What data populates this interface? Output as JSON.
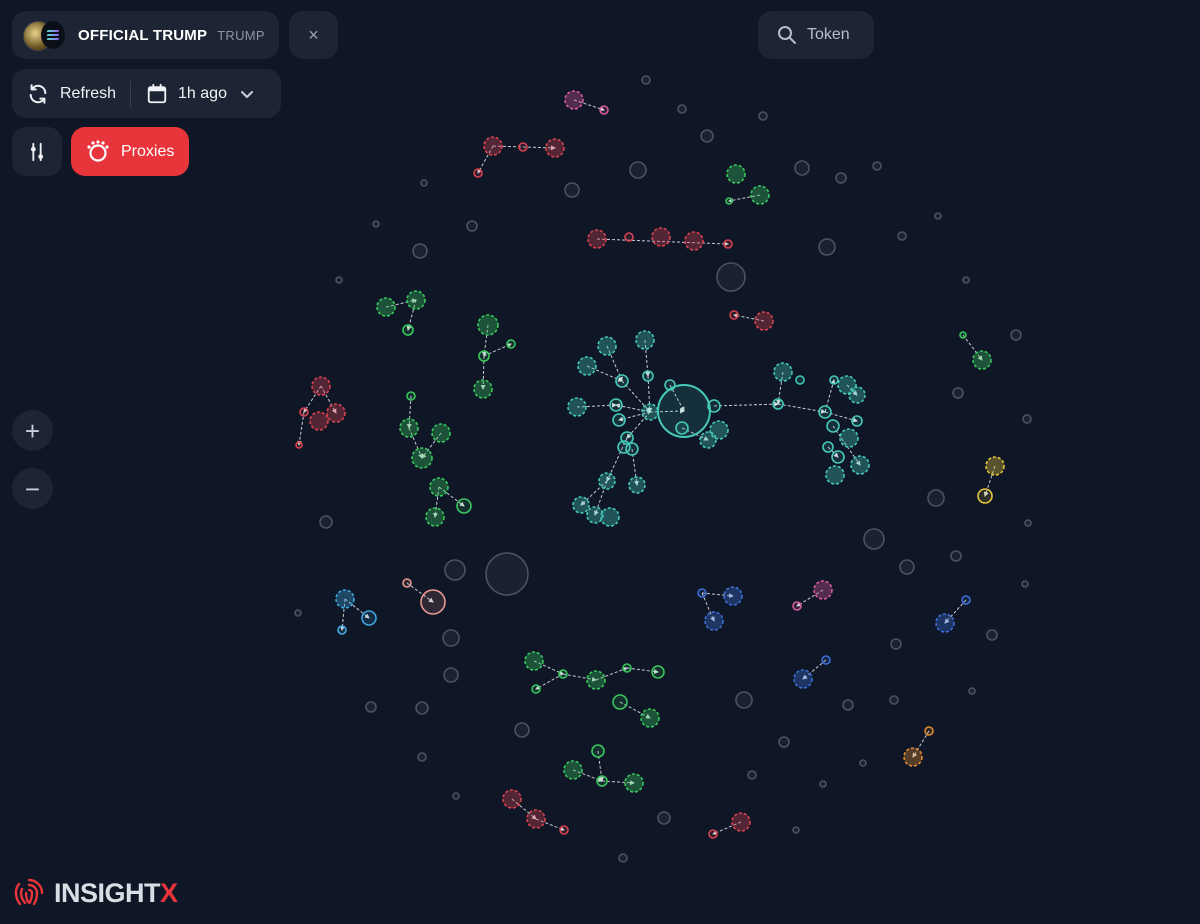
{
  "token": {
    "name": "OFFICIAL TRUMP",
    "symbol": "TRUMP",
    "logo_icon": "token-logo-icon",
    "chain_icon": "solana-icon"
  },
  "header": {
    "close_label": "×",
    "search_label": "Token"
  },
  "toolbar": {
    "refresh_label": "Refresh",
    "time_label": "1h ago"
  },
  "filters": {
    "proxies_label": "Proxies"
  },
  "zoom": {
    "in_label": "+",
    "out_label": "−"
  },
  "brand": {
    "name_main": "INSIGHT",
    "name_accent": "X"
  },
  "colors": {
    "background": "#0f1626",
    "panel": "#1d2534",
    "accent_red": "#e8343b",
    "teal": "#45c9b8",
    "green": "#38c75d",
    "red": "#d8434f",
    "pink": "#d65a9c",
    "blue": "#3d6fd6",
    "lightblue": "#3fa6e0",
    "yellow": "#e3c53a",
    "orange": "#e08a2f",
    "salmon": "#e89a90",
    "grey": "#4b5263"
  },
  "clusters": [
    {
      "color": "teal",
      "nodes": [
        [
          684,
          411,
          26
        ],
        [
          650,
          412,
          8
        ],
        [
          714,
          406,
          6
        ],
        [
          682,
          428,
          6
        ],
        [
          708,
          440,
          8
        ],
        [
          719,
          430,
          9
        ],
        [
          607,
          346,
          9
        ],
        [
          587,
          366,
          9
        ],
        [
          645,
          340,
          9
        ],
        [
          622,
          381,
          6
        ],
        [
          648,
          376,
          5
        ],
        [
          670,
          385,
          5
        ],
        [
          577,
          407,
          9
        ],
        [
          616,
          405,
          6
        ],
        [
          619,
          420,
          6
        ],
        [
          627,
          438,
          6
        ],
        [
          624,
          447,
          6
        ],
        [
          632,
          449,
          6
        ],
        [
          607,
          481,
          8
        ],
        [
          637,
          485,
          8
        ],
        [
          581,
          505,
          8
        ],
        [
          595,
          515,
          8
        ],
        [
          610,
          517,
          9
        ],
        [
          783,
          372,
          9
        ],
        [
          800,
          380,
          4
        ],
        [
          778,
          404,
          5
        ],
        [
          825,
          412,
          6
        ],
        [
          834,
          380,
          4
        ],
        [
          847,
          385,
          9
        ],
        [
          857,
          395,
          8
        ],
        [
          857,
          421,
          5
        ],
        [
          833,
          426,
          6
        ],
        [
          849,
          438,
          9
        ],
        [
          828,
          447,
          5
        ],
        [
          838,
          457,
          6
        ],
        [
          860,
          465,
          9
        ],
        [
          835,
          475,
          9
        ]
      ],
      "edges": [
        [
          650,
          412,
          684,
          411
        ],
        [
          714,
          406,
          778,
          404
        ],
        [
          778,
          404,
          825,
          412
        ],
        [
          607,
          346,
          622,
          381
        ],
        [
          587,
          366,
          622,
          381
        ],
        [
          645,
          340,
          648,
          376
        ],
        [
          577,
          407,
          616,
          405
        ],
        [
          650,
          412,
          616,
          405
        ],
        [
          650,
          412,
          619,
          420
        ],
        [
          650,
          412,
          627,
          438
        ],
        [
          627,
          438,
          607,
          481
        ],
        [
          607,
          481,
          595,
          515
        ],
        [
          607,
          481,
          581,
          505
        ],
        [
          632,
          449,
          637,
          485
        ],
        [
          783,
          372,
          778,
          404
        ],
        [
          825,
          412,
          834,
          380
        ],
        [
          825,
          412,
          857,
          421
        ],
        [
          833,
          426,
          860,
          465
        ],
        [
          828,
          447,
          838,
          457
        ],
        [
          847,
          385,
          857,
          395
        ],
        [
          682,
          428,
          708,
          440
        ],
        [
          622,
          381,
          650,
          412
        ],
        [
          648,
          376,
          650,
          412
        ],
        [
          670,
          385,
          684,
          411
        ]
      ]
    },
    {
      "color": "green",
      "nodes": [
        [
          488,
          325,
          10
        ],
        [
          484,
          356,
          5
        ],
        [
          511,
          344,
          4
        ],
        [
          483,
          389,
          9
        ],
        [
          386,
          307,
          9
        ],
        [
          416,
          300,
          9
        ],
        [
          408,
          330,
          5
        ],
        [
          411,
          396,
          4
        ],
        [
          409,
          428,
          9
        ],
        [
          441,
          433,
          9
        ],
        [
          422,
          458,
          10
        ],
        [
          439,
          487,
          9
        ],
        [
          464,
          506,
          7
        ],
        [
          435,
          517,
          9
        ],
        [
          736,
          174,
          9
        ],
        [
          760,
          195,
          9
        ],
        [
          729,
          201,
          3
        ],
        [
          982,
          360,
          9
        ],
        [
          963,
          335,
          3
        ],
        [
          534,
          661,
          9
        ],
        [
          563,
          674,
          4
        ],
        [
          536,
          689,
          4
        ],
        [
          596,
          680,
          9
        ],
        [
          627,
          668,
          4
        ],
        [
          658,
          672,
          6
        ],
        [
          620,
          702,
          7
        ],
        [
          650,
          718,
          9
        ],
        [
          598,
          751,
          6
        ],
        [
          573,
          770,
          9
        ],
        [
          602,
          781,
          5
        ],
        [
          634,
          783,
          9
        ]
      ],
      "edges": [
        [
          488,
          325,
          484,
          356
        ],
        [
          484,
          356,
          511,
          344
        ],
        [
          484,
          356,
          483,
          389
        ],
        [
          416,
          300,
          408,
          330
        ],
        [
          386,
          307,
          416,
          300
        ],
        [
          411,
          396,
          409,
          428
        ],
        [
          409,
          428,
          422,
          458
        ],
        [
          441,
          433,
          422,
          458
        ],
        [
          439,
          487,
          464,
          506
        ],
        [
          439,
          487,
          435,
          517
        ],
        [
          760,
          195,
          729,
          201
        ],
        [
          963,
          335,
          982,
          360
        ],
        [
          534,
          661,
          563,
          674
        ],
        [
          563,
          674,
          536,
          689
        ],
        [
          563,
          674,
          596,
          680
        ],
        [
          627,
          668,
          658,
          672
        ],
        [
          596,
          680,
          627,
          668
        ],
        [
          620,
          702,
          650,
          718
        ],
        [
          598,
          751,
          602,
          781
        ],
        [
          573,
          770,
          602,
          781
        ],
        [
          602,
          781,
          634,
          783
        ]
      ]
    },
    {
      "color": "red",
      "nodes": [
        [
          493,
          146,
          9
        ],
        [
          523,
          147,
          4
        ],
        [
          555,
          148,
          9
        ],
        [
          478,
          173,
          4
        ],
        [
          597,
          239,
          9
        ],
        [
          629,
          237,
          4
        ],
        [
          661,
          237,
          9
        ],
        [
          694,
          241,
          9
        ],
        [
          728,
          244,
          4
        ],
        [
          764,
          321,
          9
        ],
        [
          734,
          315,
          4
        ],
        [
          321,
          386,
          9
        ],
        [
          304,
          412,
          4
        ],
        [
          319,
          421,
          9
        ],
        [
          336,
          413,
          9
        ],
        [
          299,
          445,
          3
        ],
        [
          512,
          799,
          9
        ],
        [
          536,
          819,
          9
        ],
        [
          564,
          830,
          4
        ],
        [
          741,
          822,
          9
        ],
        [
          713,
          834,
          4
        ]
      ],
      "edges": [
        [
          493,
          146,
          555,
          148
        ],
        [
          493,
          146,
          478,
          173
        ],
        [
          597,
          239,
          728,
          244
        ],
        [
          764,
          321,
          734,
          315
        ],
        [
          321,
          386,
          304,
          412
        ],
        [
          321,
          386,
          336,
          413
        ],
        [
          304,
          412,
          299,
          445
        ],
        [
          512,
          799,
          536,
          819
        ],
        [
          536,
          819,
          564,
          830
        ],
        [
          741,
          822,
          713,
          834
        ]
      ]
    },
    {
      "color": "pink",
      "nodes": [
        [
          574,
          100,
          9
        ],
        [
          604,
          110,
          4
        ],
        [
          823,
          590,
          9
        ],
        [
          797,
          606,
          4
        ]
      ],
      "edges": [
        [
          574,
          100,
          604,
          110
        ],
        [
          823,
          590,
          797,
          606
        ]
      ]
    },
    {
      "color": "blue",
      "nodes": [
        [
          733,
          596,
          9
        ],
        [
          702,
          593,
          4
        ],
        [
          714,
          621,
          9
        ],
        [
          945,
          623,
          9
        ],
        [
          966,
          600,
          4
        ],
        [
          803,
          679,
          9
        ],
        [
          826,
          660,
          4
        ]
      ],
      "edges": [
        [
          702,
          593,
          733,
          596
        ],
        [
          702,
          593,
          714,
          621
        ],
        [
          966,
          600,
          945,
          623
        ],
        [
          826,
          660,
          803,
          679
        ]
      ]
    },
    {
      "color": "lightblue",
      "nodes": [
        [
          345,
          599,
          9
        ],
        [
          369,
          618,
          7
        ],
        [
          342,
          630,
          4
        ]
      ],
      "edges": [
        [
          345,
          599,
          369,
          618
        ],
        [
          345,
          599,
          342,
          630
        ]
      ]
    },
    {
      "color": "yellow",
      "nodes": [
        [
          995,
          466,
          9
        ],
        [
          985,
          496,
          7
        ]
      ],
      "edges": [
        [
          995,
          466,
          985,
          496
        ]
      ]
    },
    {
      "color": "orange",
      "nodes": [
        [
          913,
          757,
          9
        ],
        [
          929,
          731,
          4
        ]
      ],
      "edges": [
        [
          929,
          731,
          913,
          757
        ]
      ]
    },
    {
      "color": "salmon",
      "nodes": [
        [
          433,
          602,
          12
        ],
        [
          407,
          583,
          4
        ]
      ],
      "edges": [
        [
          407,
          583,
          433,
          602
        ]
      ]
    }
  ],
  "grey_nodes": [
    [
      646,
      80,
      4
    ],
    [
      682,
      109,
      4
    ],
    [
      707,
      136,
      6
    ],
    [
      763,
      116,
      4
    ],
    [
      572,
      190,
      7
    ],
    [
      638,
      170,
      8
    ],
    [
      802,
      168,
      7
    ],
    [
      841,
      178,
      5
    ],
    [
      877,
      166,
      4
    ],
    [
      424,
      183,
      3
    ],
    [
      472,
      226,
      5
    ],
    [
      376,
      224,
      3
    ],
    [
      420,
      251,
      7
    ],
    [
      339,
      280,
      3
    ],
    [
      731,
      277,
      14
    ],
    [
      827,
      247,
      8
    ],
    [
      902,
      236,
      4
    ],
    [
      938,
      216,
      3
    ],
    [
      966,
      280,
      3
    ],
    [
      1016,
      335,
      5
    ],
    [
      958,
      393,
      5
    ],
    [
      1027,
      419,
      4
    ],
    [
      936,
      498,
      8
    ],
    [
      1028,
      523,
      3
    ],
    [
      874,
      539,
      10
    ],
    [
      956,
      556,
      5
    ],
    [
      907,
      567,
      7
    ],
    [
      1025,
      584,
      3
    ],
    [
      992,
      635,
      5
    ],
    [
      896,
      644,
      5
    ],
    [
      972,
      691,
      3
    ],
    [
      894,
      700,
      4
    ],
    [
      848,
      705,
      5
    ],
    [
      744,
      700,
      8
    ],
    [
      784,
      742,
      5
    ],
    [
      863,
      763,
      3
    ],
    [
      752,
      775,
      4
    ],
    [
      823,
      784,
      3
    ],
    [
      796,
      830,
      3
    ],
    [
      664,
      818,
      6
    ],
    [
      623,
      858,
      4
    ],
    [
      456,
      796,
      3
    ],
    [
      422,
      757,
      4
    ],
    [
      522,
      730,
      7
    ],
    [
      422,
      708,
      6
    ],
    [
      371,
      707,
      5
    ],
    [
      451,
      675,
      7
    ],
    [
      451,
      638,
      8
    ],
    [
      298,
      613,
      3
    ],
    [
      326,
      522,
      6
    ],
    [
      455,
      570,
      10
    ],
    [
      507,
      574,
      21
    ]
  ]
}
